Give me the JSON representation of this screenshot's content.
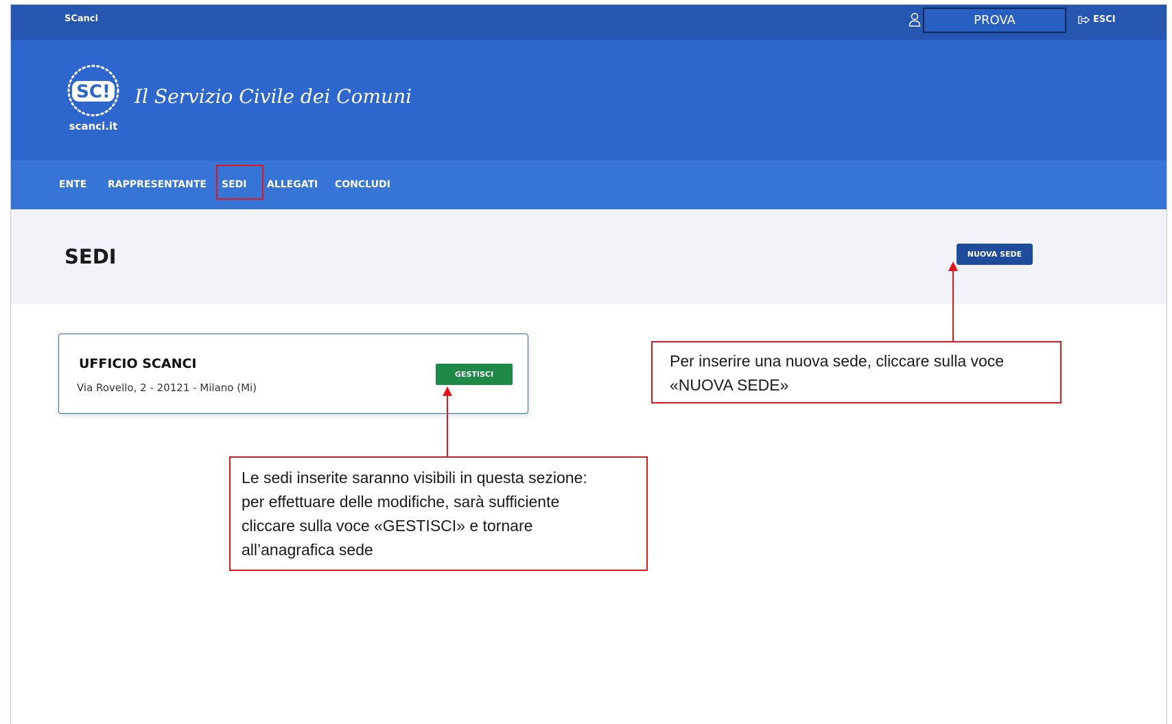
{
  "topbar": {
    "brand": "SCanci",
    "user_value": "PROVA",
    "logout_label": "ESCI",
    "icons": {
      "user": "user-icon",
      "logout": "logout-icon"
    }
  },
  "header": {
    "logo_text": "SC!",
    "logo_caption": "scanci.it",
    "site_title": "Il Servizio Civile dei Comuni"
  },
  "nav": {
    "items": [
      {
        "label": "ENTE"
      },
      {
        "label": "RAPPRESENTANTE"
      },
      {
        "label": "SEDI",
        "active": true
      },
      {
        "label": "ALLEGATI"
      },
      {
        "label": "CONCLUDI"
      }
    ]
  },
  "page": {
    "title": "SEDI",
    "new_button_label": "NUOVA SEDE"
  },
  "sedi": [
    {
      "name": "UFFICIO SCANCI",
      "address": "Via Rovello, 2 - 20121 - Milano (Mi)",
      "action_label": "GESTISCI"
    }
  ],
  "annotations": {
    "new_sede": {
      "line1": "Per inserire una nuova sede, cliccare sulla voce",
      "line2": "«NUOVA SEDE»"
    },
    "gestisci": {
      "line1": "Le sedi inserite saranno visibili in questa sezione:",
      "line2": "per effettuare delle modifiche, sarà sufficiente",
      "line3": "cliccare sulla voce «GESTISCI» e tornare",
      "line4": "all’anagrafica sede"
    }
  },
  "colors": {
    "topbar": "#2657b0",
    "header": "#2d66cc",
    "nav": "#3674d6",
    "title_band": "#f1f3f8",
    "primary_button": "#1f4c9a",
    "manage_button": "#1f8a48",
    "annotation_red": "#e3161c"
  }
}
